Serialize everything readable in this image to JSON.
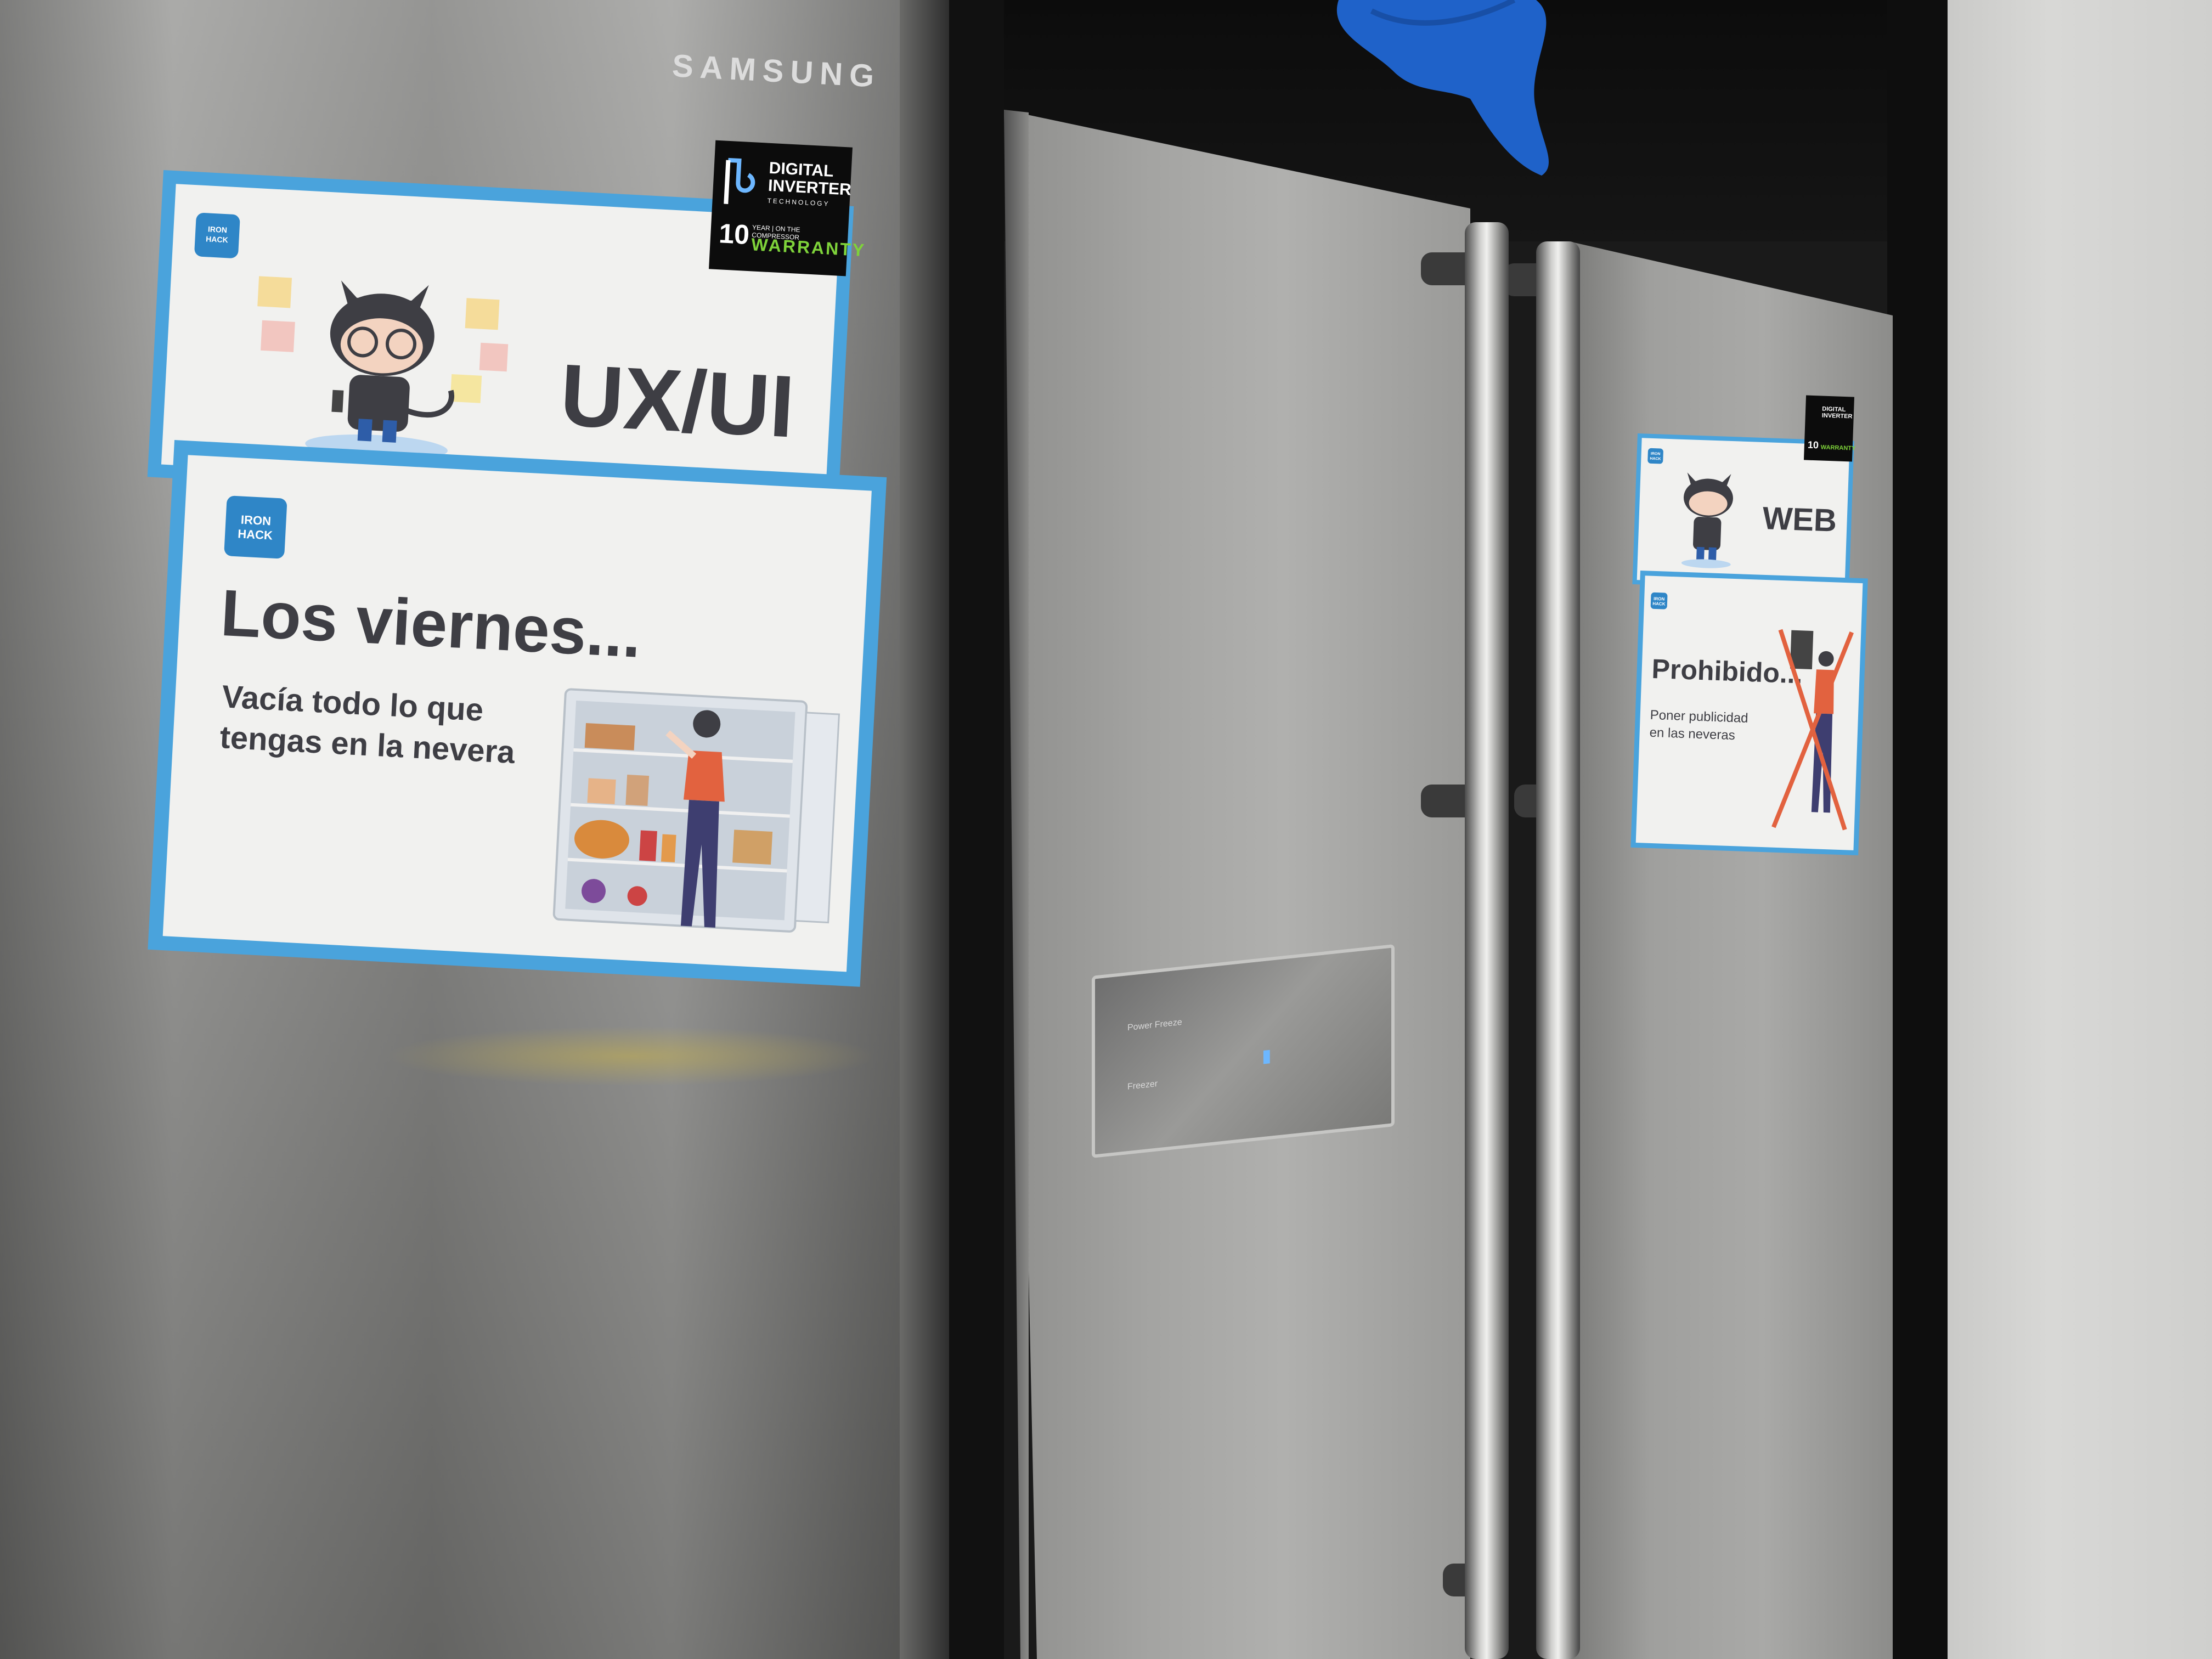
{
  "scene": "stainless steel refrigerators with signs",
  "colors": {
    "sign_border": "#4aa3dc",
    "sign_text": "#3e3e44",
    "badge": "#2f86c7",
    "warranty_green": "#7ed23a"
  },
  "left_fridge": {
    "brand": "SAMSUNG",
    "inverter_label": {
      "line1": "DIGITAL",
      "line2": "INVERTER",
      "line3": "TECHNOLOGY",
      "years": "10",
      "year_word": "YEAR",
      "note": "ON THE COMPRESSOR",
      "warranty": "WARRANTY"
    },
    "sign_uxui": {
      "badge_line1": "IRON",
      "badge_line2": "HACK",
      "title": "UX/UI"
    },
    "sign_viernes": {
      "badge_line1": "IRON",
      "badge_line2": "HACK",
      "title": "Los viernes...",
      "body_line1": "Vacía todo lo que",
      "body_line2": "tengas en la nevera"
    }
  },
  "middle_fridge": {
    "dispenser": {
      "label_power": "Power Freeze",
      "label_freezer": "Freezer"
    }
  },
  "right_fridge": {
    "inverter_label": {
      "line1": "DIGITAL",
      "line2": "INVERTER",
      "years": "10",
      "warranty": "WARRANTY"
    },
    "sign_web": {
      "badge_line1": "IRON",
      "badge_line2": "HACK",
      "title": "WEB"
    },
    "sign_prohibido": {
      "badge_line1": "IRON",
      "badge_line2": "HACK",
      "title": "Prohibido...",
      "body_line1": "Poner publicidad",
      "body_line2": "en las neveras"
    }
  }
}
